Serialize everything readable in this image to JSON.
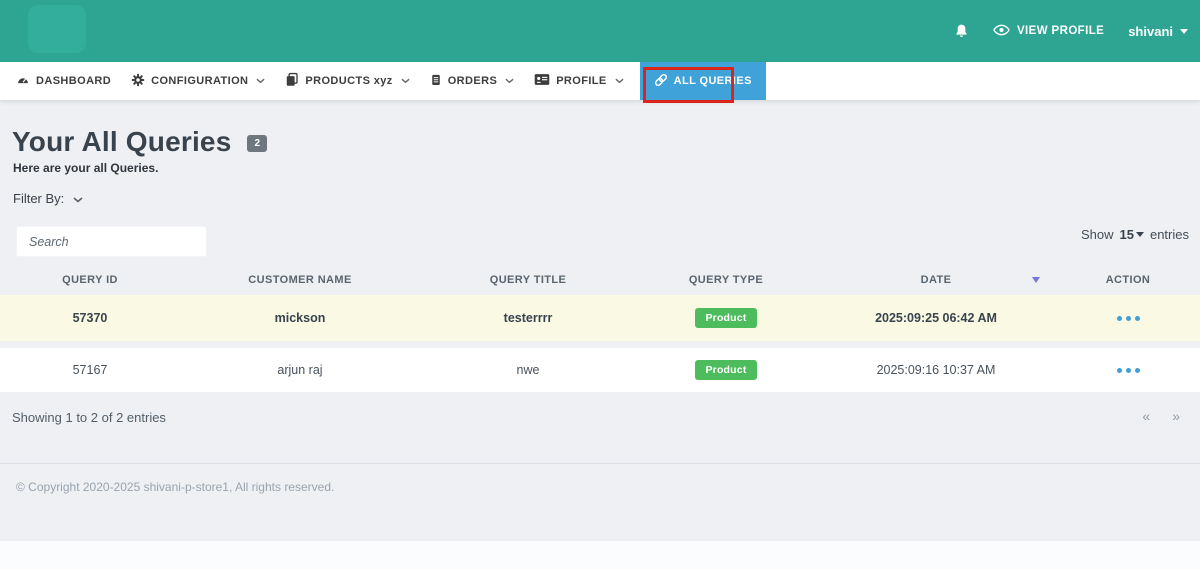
{
  "header": {
    "view_profile_label": "VIEW PROFILE",
    "user": "shivani"
  },
  "nav": {
    "items": [
      {
        "label": "DASHBOARD",
        "icon": "tachometer-icon",
        "has_dropdown": false
      },
      {
        "label": "CONFIGURATION",
        "icon": "gear-icon",
        "has_dropdown": true
      },
      {
        "label": "PRODUCTS xyz",
        "icon": "copy-icon",
        "has_dropdown": true
      },
      {
        "label": "ORDERS",
        "icon": "orders-icon",
        "has_dropdown": true
      },
      {
        "label": "PROFILE",
        "icon": "id-card-icon",
        "has_dropdown": true
      },
      {
        "label": "ALL QUERIES",
        "icon": "link-icon",
        "has_dropdown": false,
        "active": true
      }
    ]
  },
  "page": {
    "title": "Your All Queries",
    "title_badge": "2",
    "subtitle": "Here are your all Queries.",
    "filter_label": "Filter By:",
    "search_placeholder": "Search",
    "show_label": "Show",
    "show_value": "15",
    "entries_label": "entries"
  },
  "table": {
    "columns": [
      "QUERY ID",
      "CUSTOMER NAME",
      "QUERY TITLE",
      "QUERY TYPE",
      "DATE",
      "ACTION"
    ],
    "rows": [
      {
        "query_id": "57370",
        "customer_name": "mickson",
        "query_title": "testerrrr",
        "query_type": "Product",
        "date": "2025:09:25 06:42 AM"
      },
      {
        "query_id": "57167",
        "customer_name": "arjun raj",
        "query_title": "nwe",
        "query_type": "Product",
        "date": "2025:09:16 10:37 AM"
      }
    ],
    "summary": "Showing 1 to 2 of 2 entries",
    "pagination": {
      "prev": "«",
      "next": "»"
    }
  },
  "footer": {
    "copyright": "© Copyright 2020-2025 shivani-p-store1, All rights reserved."
  },
  "colors": {
    "header_teal": "#2ea593",
    "active_tab_blue": "#3fa2d9",
    "annotation_red": "#db251c",
    "row_highlight_yellow": "#fafae4",
    "badge_green": "#4cbc5c",
    "action_dot_blue": "#3f9fd9"
  }
}
